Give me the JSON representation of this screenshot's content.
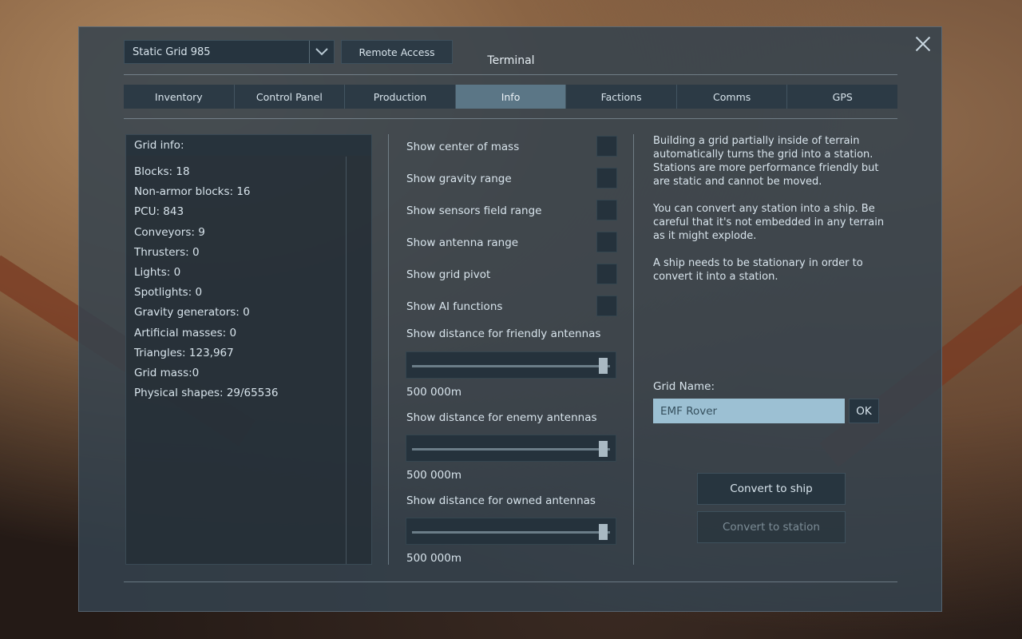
{
  "window": {
    "title": "Terminal"
  },
  "grid_selector": {
    "value": "Static Grid 985"
  },
  "remote_access_label": "Remote Access",
  "tabs": [
    {
      "label": "Inventory"
    },
    {
      "label": "Control Panel"
    },
    {
      "label": "Production"
    },
    {
      "label": "Info",
      "active": true
    },
    {
      "label": "Factions"
    },
    {
      "label": "Comms"
    },
    {
      "label": "GPS"
    }
  ],
  "grid_info": {
    "header": "Grid info:",
    "lines": [
      "Blocks: 18",
      "Non-armor blocks: 16",
      "PCU: 843",
      "Conveyors: 9",
      "Thrusters: 0",
      "Lights: 0",
      "Spotlights: 0",
      "Gravity generators: 0",
      "Artificial masses: 0",
      "Triangles: 123,967",
      "Grid mass:0",
      "Physical shapes: 29/65536"
    ]
  },
  "options": {
    "center_of_mass": "Show center of mass",
    "gravity_range": "Show gravity range",
    "sensors_range": "Show sensors field range",
    "antenna_range": "Show antenna range",
    "grid_pivot": "Show grid pivot",
    "ai_functions": "Show AI functions"
  },
  "sliders": {
    "friendly": {
      "label": "Show distance for friendly antennas",
      "value_text": "500 000m"
    },
    "enemy": {
      "label": "Show distance for enemy antennas",
      "value_text": "500 000m"
    },
    "owned": {
      "label": "Show distance for owned antennas",
      "value_text": "500 000m"
    }
  },
  "help": {
    "p1": "Building a grid partially inside of terrain automatically turns the grid into a station. Stations are more performance friendly but are static and cannot be moved.",
    "p2": "You can convert any station into a ship. Be careful that it's not embedded in any terrain as it might explode.",
    "p3": "A ship needs to be stationary in order to convert it into a station."
  },
  "grid_name": {
    "label": "Grid Name:",
    "value": "EMF Rover",
    "ok_label": "OK"
  },
  "buttons": {
    "convert_to_ship": "Convert to ship",
    "convert_to_station": "Convert to station"
  },
  "colors": {
    "active_tab": "#5b7686",
    "input_bg": "#9cc0d3",
    "panel_bg": "#34424e"
  }
}
